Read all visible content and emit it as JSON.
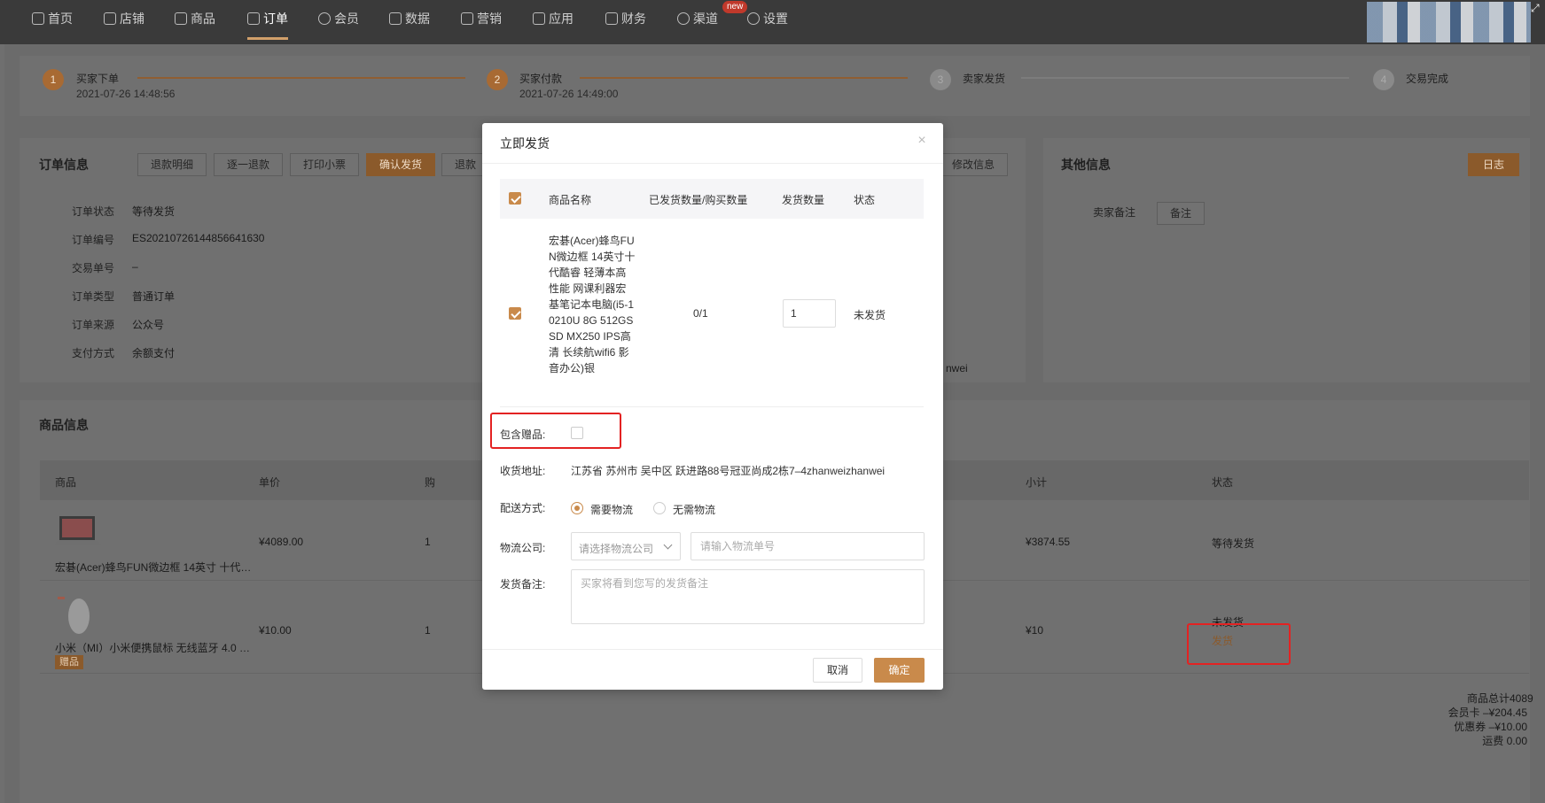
{
  "nav": {
    "items": [
      "首页",
      "店铺",
      "商品",
      "订单",
      "会员",
      "数据",
      "营销",
      "应用",
      "财务",
      "渠道",
      "设置"
    ],
    "new_badge": "new"
  },
  "steps": [
    {
      "num": "1",
      "title": "买家下单",
      "time": "2021-07-26 14:48:56"
    },
    {
      "num": "2",
      "title": "买家付款",
      "time": "2021-07-26 14:49:00"
    },
    {
      "num": "3",
      "title": "卖家发货",
      "time": ""
    },
    {
      "num": "4",
      "title": "交易完成",
      "time": ""
    }
  ],
  "order_info": {
    "title": "订单信息",
    "buttons": [
      "退款明细",
      "逐一退款",
      "打印小票",
      "确认发货",
      "退款"
    ],
    "right_button": "修改信息",
    "fields": [
      {
        "label": "订单状态",
        "value": "等待发货"
      },
      {
        "label": "订单编号",
        "value": "ES20210726144856641630"
      },
      {
        "label": "交易单号",
        "value": "–"
      },
      {
        "label": "订单类型",
        "value": "普通订单"
      },
      {
        "label": "订单来源",
        "value": "公众号"
      },
      {
        "label": "支付方式",
        "value": "余额支付"
      }
    ],
    "partial_text": "nwei"
  },
  "other_info": {
    "title": "其他信息",
    "log_button": "日志",
    "seller_note_label": "卖家备注",
    "note_button": "备注"
  },
  "goods_info": {
    "title": "商品信息",
    "columns": [
      "商品",
      "单价",
      "购",
      "小计",
      "状态"
    ],
    "rows": [
      {
        "name": "宏碁(Acer)蜂鸟FUN微边框 14英寸 十代…",
        "price": "¥4089.00",
        "qty": "1",
        "subtotal": "¥3874.55",
        "status": "等待发货",
        "action": "",
        "gift": ""
      },
      {
        "name": "小米（MI）小米便携鼠标 无线蓝牙 4.0 …",
        "price": "¥10.00",
        "qty": "1",
        "subtotal": "¥10",
        "status": "未发货",
        "action": "发货",
        "gift": "赠品"
      }
    ]
  },
  "totals": [
    "商品总计4089",
    "会员卡 –¥204.45",
    "优惠券 –¥10.00",
    "运费 0.00"
  ],
  "modal": {
    "title": "立即发货",
    "close": "×",
    "table_headers": [
      "商品名称",
      "已发货数量/购买数量",
      "发货数量",
      "状态"
    ],
    "product": {
      "name": "宏碁(Acer)蜂鸟FUN微边框 14英寸十代酷睿 轻薄本高性能 网课利器宏基笔记本电脑(i5-10210U 8G 512GSSD MX250 IPS高清 长续航wifi6 影音办公)银",
      "shipped": "0/1",
      "qty": "1",
      "status": "未发货"
    },
    "gift_label": "包含赠品:",
    "address_label": "收货地址:",
    "address": "江苏省 苏州市 吴中区 跃进路88号冠亚尚成2栋7–4zhanweizhanwei",
    "delivery_label": "配送方式:",
    "delivery_options": [
      "需要物流",
      "无需物流"
    ],
    "logistics_label": "物流公司:",
    "logistics_placeholder": "请选择物流公司",
    "tracking_placeholder": "请输入物流单号",
    "remark_label": "发货备注:",
    "remark_placeholder": "买家将看到您写的发货备注",
    "cancel": "取消",
    "confirm": "确定"
  }
}
